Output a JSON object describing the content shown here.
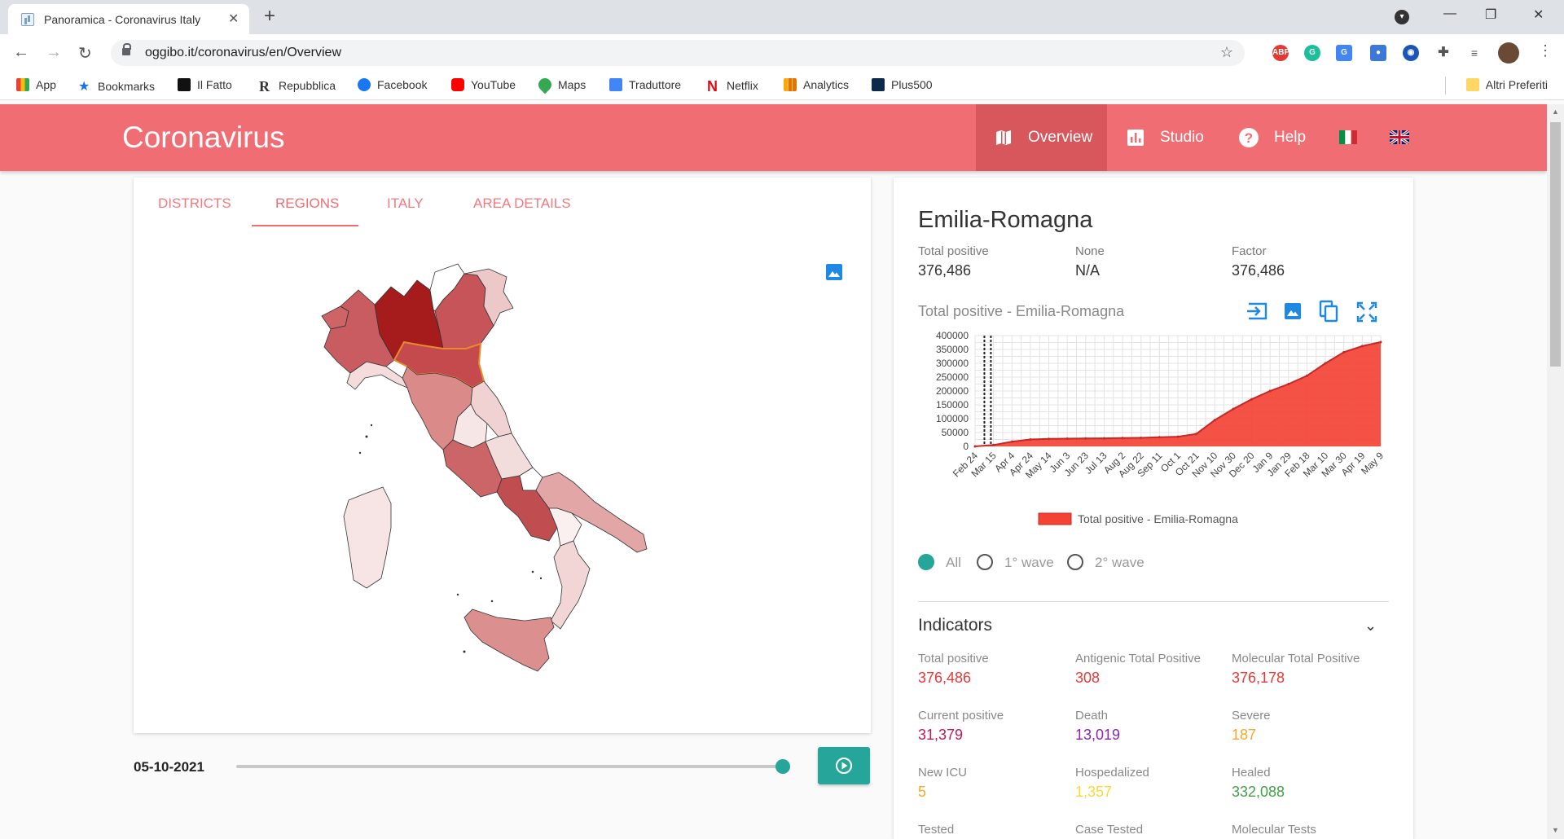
{
  "browser": {
    "tab_title": "Panoramica - Coronavirus Italy",
    "url": "oggibo.it/coronavirus/en/Overview",
    "bookmarks": [
      {
        "label": "App",
        "color": "#4285f4"
      },
      {
        "label": "Bookmarks",
        "color": "#1a73e8"
      },
      {
        "label": "Il Fatto",
        "color": "#111111"
      },
      {
        "label": "Repubblica",
        "color": "#111111"
      },
      {
        "label": "Facebook",
        "color": "#1877f2"
      },
      {
        "label": "YouTube",
        "color": "#ff0000"
      },
      {
        "label": "Maps",
        "color": "#34a853"
      },
      {
        "label": "Traduttore",
        "color": "#4285f4"
      },
      {
        "label": "Netflix",
        "color": "#e50914"
      },
      {
        "label": "Analytics",
        "color": "#f9ab00"
      },
      {
        "label": "Plus500",
        "color": "#0b2a4a"
      }
    ],
    "other_bookmarks": "Altri Preferiti"
  },
  "app": {
    "title": "Coronavirus",
    "nav": [
      {
        "label": "Overview",
        "icon": "map-icon",
        "active": true
      },
      {
        "label": "Studio",
        "icon": "bar-chart-icon",
        "active": false
      },
      {
        "label": "Help",
        "icon": "help-icon",
        "active": false
      }
    ],
    "languages": [
      "italian-flag-icon",
      "uk-flag-icon"
    ],
    "accent": "#f06e73",
    "teal": "#26a69a"
  },
  "map_panel": {
    "tabs": [
      "DISTRICTS",
      "REGIONS",
      "ITALY",
      "AREA DETAILS"
    ],
    "active_tab": "REGIONS",
    "selected_region": "Emilia-Romagna",
    "date": "05-10-2021",
    "slider_fraction": 1.0
  },
  "detail": {
    "region": "Emilia-Romagna",
    "summary": [
      {
        "label": "Total positive",
        "value": "376,486"
      },
      {
        "label": "None",
        "value": "N/A"
      },
      {
        "label": "Factor",
        "value": "376,486"
      }
    ],
    "chart_title": "Total positive - Emilia-Romagna",
    "radios": [
      {
        "label": "All",
        "checked": true
      },
      {
        "label": "1° wave",
        "checked": false
      },
      {
        "label": "2° wave",
        "checked": false
      }
    ],
    "indicators_title": "Indicators",
    "indicators": [
      {
        "label": "Total positive",
        "value": "376,486",
        "color": "#e53935"
      },
      {
        "label": "Antigenic Total Positive",
        "value": "308",
        "color": "#e53935"
      },
      {
        "label": "Molecular Total Positive",
        "value": "376,178",
        "color": "#e53935"
      },
      {
        "label": "Current positive",
        "value": "31,379",
        "color": "#c2185b"
      },
      {
        "label": "Death",
        "value": "13,019",
        "color": "#8e24aa"
      },
      {
        "label": "Severe",
        "value": "187",
        "color": "#f9a825"
      },
      {
        "label": "New ICU",
        "value": "5",
        "color": "#f9a825"
      },
      {
        "label": "Hospedalized",
        "value": "1,357",
        "color": "#fdd835"
      },
      {
        "label": "Healed",
        "value": "332,088",
        "color": "#43a047"
      },
      {
        "label": "Tested",
        "value": "",
        "color": "#333333"
      },
      {
        "label": "Case Tested",
        "value": "",
        "color": "#333333"
      },
      {
        "label": "Molecular Tests",
        "value": "",
        "color": "#333333"
      }
    ]
  },
  "chart_data": {
    "type": "area",
    "title": "Total positive - Emilia-Romagna",
    "legend": [
      "Total positive - Emilia-Romagna"
    ],
    "legend_position": "bottom",
    "grid": true,
    "ylim": [
      0,
      400000
    ],
    "yticks": [
      0,
      50000,
      100000,
      150000,
      200000,
      250000,
      300000,
      350000,
      400000
    ],
    "xticks": [
      "Feb 24",
      "Mar 15",
      "Apr 4",
      "Apr 24",
      "May 14",
      "Jun 3",
      "Jun 23",
      "Jul 13",
      "Aug 2",
      "Aug 22",
      "Sep 11",
      "Oct 1",
      "Oct 21",
      "Nov 10",
      "Nov 30",
      "Dec 20",
      "Jan 9",
      "Jan 29",
      "Feb 18",
      "Mar 10",
      "Mar 30",
      "Apr 19",
      "May 9"
    ],
    "series": [
      {
        "name": "Total positive - Emilia-Romagna",
        "color": "#f44336",
        "x": [
          "Feb 24",
          "Mar 15",
          "Apr 4",
          "Apr 24",
          "May 14",
          "Jun 3",
          "Jun 23",
          "Jul 13",
          "Aug 2",
          "Aug 22",
          "Sep 11",
          "Oct 1",
          "Oct 21",
          "Nov 10",
          "Nov 30",
          "Dec 20",
          "Jan 9",
          "Jan 29",
          "Feb 18",
          "Mar 10",
          "Mar 30",
          "Apr 19",
          "May 9"
        ],
        "values": [
          0,
          5000,
          17000,
          25000,
          27000,
          28000,
          28500,
          29000,
          30000,
          31000,
          33000,
          35000,
          45000,
          95000,
          135000,
          170000,
          200000,
          225000,
          255000,
          300000,
          340000,
          362000,
          376486
        ]
      }
    ]
  }
}
